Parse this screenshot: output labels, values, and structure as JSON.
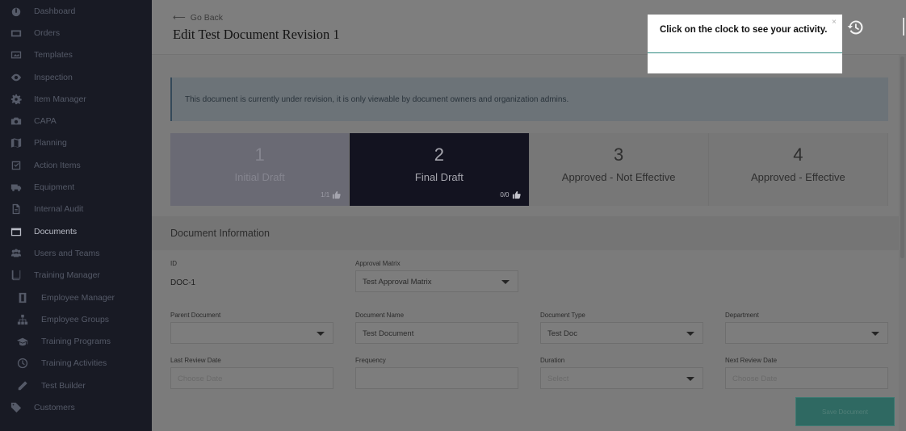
{
  "sidebar": {
    "items": [
      {
        "label": "Dashboard",
        "icon": "dashboard-icon"
      },
      {
        "label": "Orders",
        "icon": "orders-icon"
      },
      {
        "label": "Templates",
        "icon": "templates-icon"
      },
      {
        "label": "Inspection",
        "icon": "eye-icon"
      },
      {
        "label": "Item Manager",
        "icon": "gear-icon"
      },
      {
        "label": "CAPA",
        "icon": "camera-icon"
      },
      {
        "label": "Planning",
        "icon": "map-icon"
      },
      {
        "label": "Action Items",
        "icon": "checkbox-icon"
      },
      {
        "label": "Equipment",
        "icon": "truck-icon"
      },
      {
        "label": "Internal Audit",
        "icon": "file-icon"
      },
      {
        "label": "Documents",
        "icon": "folder-icon"
      },
      {
        "label": "Users and Teams",
        "icon": "users-icon"
      },
      {
        "label": "Training Manager",
        "icon": "book-icon"
      },
      {
        "label": "Employee Manager",
        "icon": "id-card-icon"
      },
      {
        "label": "Employee Groups",
        "icon": "sitemap-icon"
      },
      {
        "label": "Training Programs",
        "icon": "graduation-cap-icon"
      },
      {
        "label": "Training Activities",
        "icon": "clock-icon"
      },
      {
        "label": "Test Builder",
        "icon": "pencil-icon"
      },
      {
        "label": "Customers",
        "icon": "tag-icon"
      }
    ],
    "active_item": "Documents"
  },
  "header": {
    "go_back": "Go Back",
    "title": "Edit Test Document Revision 1"
  },
  "alert": {
    "text": "This document is currently under revision, it is only viewable by document owners and organization admins."
  },
  "steps": [
    {
      "number": "1",
      "label": "Initial Draft",
      "count": "1/1",
      "state": "done"
    },
    {
      "number": "2",
      "label": "Final Draft",
      "count": "0/0",
      "state": "current"
    },
    {
      "number": "3",
      "label": "Approved - Not Effective",
      "count": "",
      "state": "pending"
    },
    {
      "number": "4",
      "label": "Approved - Effective",
      "count": "",
      "state": "pending"
    }
  ],
  "section": {
    "title": "Document Information"
  },
  "fields": {
    "id": {
      "label": "ID",
      "value": "DOC-1"
    },
    "approval_matrix": {
      "label": "Approval Matrix",
      "value": "Test Approval Matrix"
    },
    "parent_document": {
      "label": "Parent Document",
      "value": ""
    },
    "document_name": {
      "label": "Document Name",
      "value": "Test Document"
    },
    "document_type": {
      "label": "Document Type",
      "value": "Test Doc"
    },
    "department": {
      "label": "Department",
      "value": ""
    },
    "last_review_date": {
      "label": "Last Review Date",
      "placeholder": "Choose Date"
    },
    "frequency": {
      "label": "Frequency",
      "value": ""
    },
    "duration": {
      "label": "Duration",
      "placeholder": "Select"
    },
    "next_review_date": {
      "label": "Next Review Date",
      "placeholder": "Choose Date"
    }
  },
  "actions": {
    "save": "Save Document"
  },
  "tooltip": {
    "text": "Click on the clock to see your activity.",
    "close": "×"
  },
  "colors": {
    "sidebar_bg": "#181a24",
    "accent_teal": "#2f8a80",
    "current_step_bg": "#131320"
  }
}
